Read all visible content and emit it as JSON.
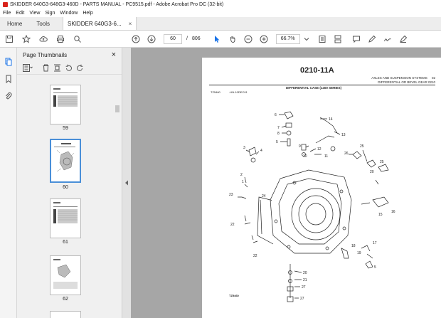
{
  "window": {
    "title": "SKIDDER 640G3-648G3-460D - PARTS MANUAL - PC9515.pdf - Adobe Acrobat Pro DC (32-bit)"
  },
  "menu": [
    "File",
    "Edit",
    "View",
    "Sign",
    "Window",
    "Help"
  ],
  "tabs": {
    "home": "Home",
    "tools": "Tools",
    "document": "SKIDDER 640G3-6...",
    "close": "×"
  },
  "toolbar": {
    "current_page": "60",
    "page_sep": "/",
    "total_pages": "806",
    "zoom": "66.7%"
  },
  "panel": {
    "title": "Page Thumbnails",
    "close": "×",
    "thumbnails": [
      {
        "label": "59"
      },
      {
        "label": "60"
      },
      {
        "label": "61"
      },
      {
        "label": "62"
      }
    ]
  },
  "page_content": {
    "section_code": "0210-11A",
    "header_right_1": "AXLES AND SUSPENSION SYSTEMS     02",
    "header_right_2": "DIFFERENTIAL OR BEVEL GEAR 0210",
    "subtitle": "DIFFERENTIAL CASE (1400 SERIES)",
    "ref_left": "TZ5460",
    "ref_mid": "-UN-10DEC01",
    "footer_ref": "TZ5460",
    "callouts": [
      "6",
      "14",
      "7",
      "8",
      "13",
      "9",
      "12",
      "10",
      "11",
      "3",
      "4",
      "26",
      "25",
      "2",
      "1",
      "20",
      "25",
      "24",
      "16",
      "15",
      "17",
      "23",
      "19",
      "18",
      "5",
      "22",
      "22",
      "20",
      "21",
      "27",
      "27"
    ]
  },
  "colors": {
    "accent": "#d9231c",
    "select_blue": "#4a8fd8",
    "viewer_bg": "#a6a6a6"
  }
}
